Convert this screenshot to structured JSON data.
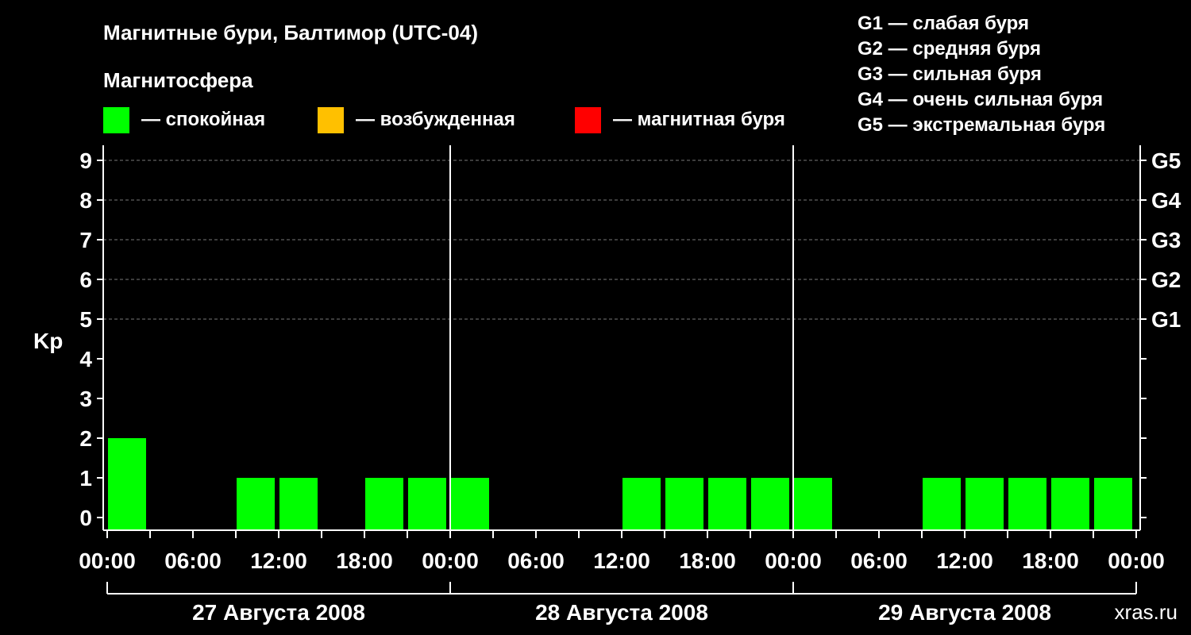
{
  "chart_data": {
    "type": "bar",
    "title": "Магнитные бури, Балтимор (UTC-04)",
    "legend_title": "Магнитосфера",
    "legend": [
      {
        "label": "— спокойная",
        "color": "#00ff00"
      },
      {
        "label": "— возбужденная",
        "color": "#ffc000"
      },
      {
        "label": "— магнитная буря",
        "color": "#ff0000"
      }
    ],
    "storm_legend": [
      "G1 — слабая буря",
      "G2 — средняя буря",
      "G3 — сильная буря",
      "G4 — очень сильная буря",
      "G5 — экстремальная буря"
    ],
    "ylabel": "Kp",
    "ylim": [
      0,
      9
    ],
    "yticks": [
      "0",
      "1",
      "2",
      "3",
      "4",
      "5",
      "6",
      "7",
      "8",
      "9"
    ],
    "right_ticks": [
      {
        "kp": 5,
        "label": "G1"
      },
      {
        "kp": 6,
        "label": "G2"
      },
      {
        "kp": 7,
        "label": "G3"
      },
      {
        "kp": 8,
        "label": "G4"
      },
      {
        "kp": 9,
        "label": "G5"
      }
    ],
    "xticks": [
      "00:00",
      "06:00",
      "12:00",
      "18:00",
      "00:00",
      "06:00",
      "12:00",
      "18:00",
      "00:00",
      "06:00",
      "12:00",
      "18:00",
      "00:00"
    ],
    "days": [
      "27 Августа 2008",
      "28 Августа 2008",
      "29 Августа 2008"
    ],
    "interval_hours": 3,
    "values": [
      2,
      0,
      0,
      1,
      1,
      0,
      1,
      1,
      1,
      0,
      0,
      0,
      1,
      1,
      1,
      1,
      1,
      0,
      0,
      1,
      1,
      1,
      1,
      1
    ],
    "grid": "dashed at Kp 5–9"
  },
  "watermark": "xras.ru"
}
